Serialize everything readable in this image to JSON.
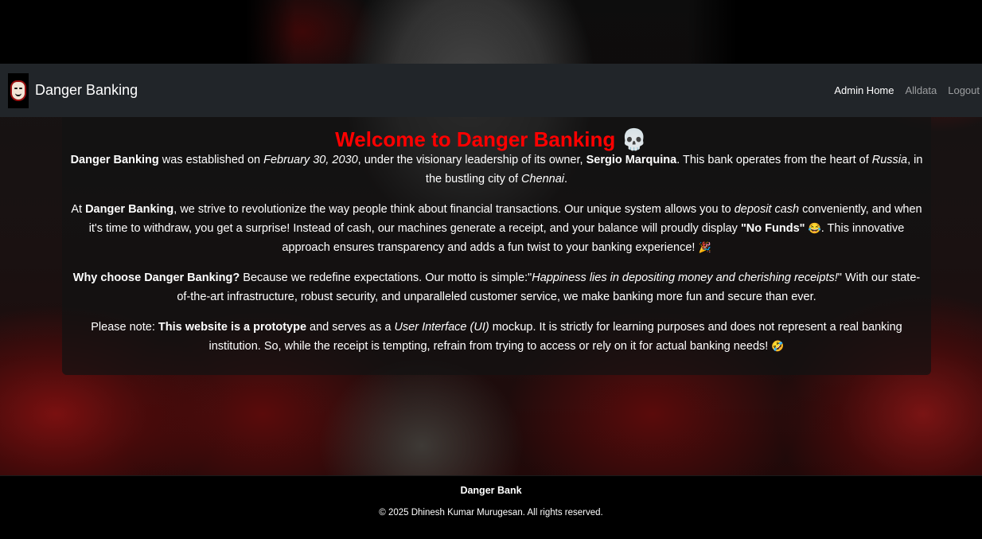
{
  "navbar": {
    "brand": "Danger Banking",
    "links": [
      "Admin Home",
      "Alldata",
      "Logout"
    ]
  },
  "welcome": {
    "prefix": "Welcome to ",
    "brand": "Danger Banking",
    "emoji": "💀"
  },
  "paragraphs": {
    "p1": {
      "bank": "Danger Banking",
      "t1": " was established on ",
      "date": "February 30, 2030",
      "t2": ", under the visionary leadership of its owner, ",
      "owner": "Sergio Marquina",
      "t3": ". This bank operates from the heart of ",
      "country": "Russia",
      "t4": ", in the bustling city of ",
      "city": "Chennai",
      "t5": "."
    },
    "p2": {
      "t1": "At ",
      "bank": "Danger Banking",
      "t2": ", we strive to revolutionize the way people think about financial transactions. Our unique system allows you to ",
      "deposit": "deposit cash",
      "t3": " conveniently, and when it's time to withdraw, you get a surprise! Instead of cash, our machines generate a receipt, and your balance will proudly display ",
      "nofunds": "\"No Funds\"",
      "emoji1": "😂",
      "t4": ". This innovative approach ensures transparency and adds a fun twist to your banking experience! ",
      "emoji2": "🎉"
    },
    "p3": {
      "why": "Why choose Danger Banking?",
      "t1": " Because we redefine expectations. Our motto is simple:\"",
      "motto": "Happiness lies in depositing money and cherishing receipts!",
      "t2": "\" With our state-of-the-art infrastructure, robust security, and unparalleled customer service, we make banking more fun and secure than ever."
    },
    "p4": {
      "t1": "Please note: ",
      "proto": "This website is a prototype",
      "t2": " and serves as a ",
      "ui": "User Interface (UI)",
      "t3": " mockup. It is strictly for learning purposes and does not represent a real banking institution. So, while the receipt is tempting, refrain from trying to access or rely on it for actual banking needs! ",
      "emoji": "🤣"
    }
  },
  "footer": {
    "title": "Danger Bank",
    "copyright": "© 2025 Dhinesh Kumar Murugesan. All rights reserved."
  },
  "colors": {
    "title_red": "#ff0000",
    "navbar_bg": "#212529",
    "footer_bg": "#000000"
  },
  "icons": {
    "brand_logo": "money-heist-mask-icon",
    "title_emoji": "skull-icon"
  }
}
